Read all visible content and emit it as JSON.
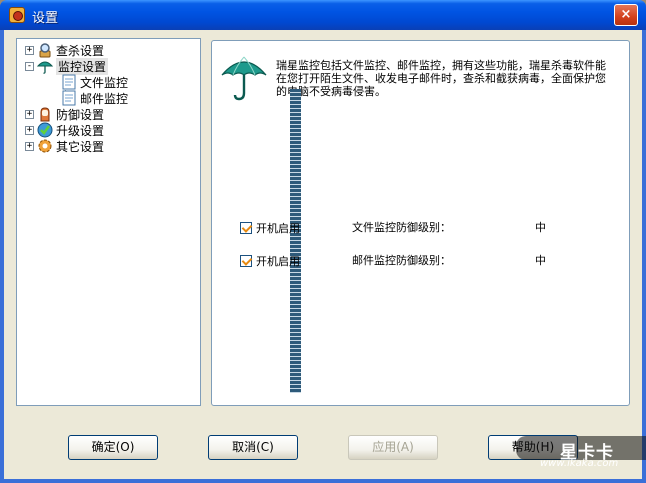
{
  "window": {
    "title": "设置",
    "close_glyph": "×"
  },
  "tree": {
    "items": [
      {
        "label": "查杀设置",
        "expander": "+",
        "icon": "magnifier-icon"
      },
      {
        "label": "监控设置",
        "expander": "-",
        "icon": "umbrella-icon",
        "selected": true,
        "children": [
          {
            "label": "文件监控",
            "icon": "document-icon"
          },
          {
            "label": "邮件监控",
            "icon": "document-icon"
          }
        ]
      },
      {
        "label": "防御设置",
        "expander": "+",
        "icon": "glove-icon"
      },
      {
        "label": "升级设置",
        "expander": "+",
        "icon": "globe-check-icon"
      },
      {
        "label": "其它设置",
        "expander": "+",
        "icon": "gear-icon"
      }
    ]
  },
  "content": {
    "description": "瑞星监控包括文件监控、邮件监控，拥有这些功能，瑞星杀毒软件能在您打开陌生文件、收发电子邮件时，查杀和截获病毒，全面保护您的电脑不受病毒侵害。",
    "monitors": [
      {
        "checkbox_label": "开机启用",
        "checked": true,
        "level_label": "文件监控防御级别：",
        "level_value": "中"
      },
      {
        "checkbox_label": "开机启用",
        "checked": true,
        "level_label": "邮件监控防御级别：",
        "level_value": "中"
      }
    ]
  },
  "buttons": {
    "ok": "确定(O)",
    "cancel": "取消(C)",
    "apply": "应用(A)",
    "help": "帮助(H)"
  },
  "watermark": {
    "logo_text": "星卡卡",
    "url": "www.ikaka.com"
  },
  "colors": {
    "titlebar": "#0054e3",
    "client_bg": "#ece9d8",
    "panel_border": "#7f9db9",
    "umbrella": "#1e9a8c"
  }
}
